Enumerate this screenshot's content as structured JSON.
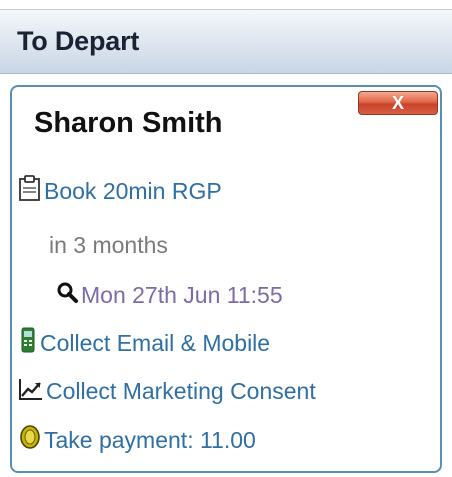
{
  "section": {
    "title": "To Depart"
  },
  "card": {
    "patient_name": "Sharon Smith",
    "close_label": "X",
    "items": {
      "booking": {
        "label": "Book 20min RGP",
        "icon": "clipboard-icon"
      },
      "recall_due": {
        "label": "in 3 months"
      },
      "appointment": {
        "label": "Mon 27th Jun 11:55",
        "icon": "search-icon"
      },
      "collect_contact": {
        "label": "Collect Email & Mobile",
        "icon": "mobile-phone-icon"
      },
      "marketing_consent": {
        "label": "Collect Marketing Consent",
        "icon": "trend-chart-icon"
      },
      "payment": {
        "label": "Take payment: 11.00",
        "icon": "coin-icon"
      }
    }
  },
  "colors": {
    "link": "#2f6fa3",
    "muted": "#7a7a7a",
    "appointment": "#7d6aa8",
    "card_border": "#5a8fb3",
    "close_button": "#d85f44"
  }
}
